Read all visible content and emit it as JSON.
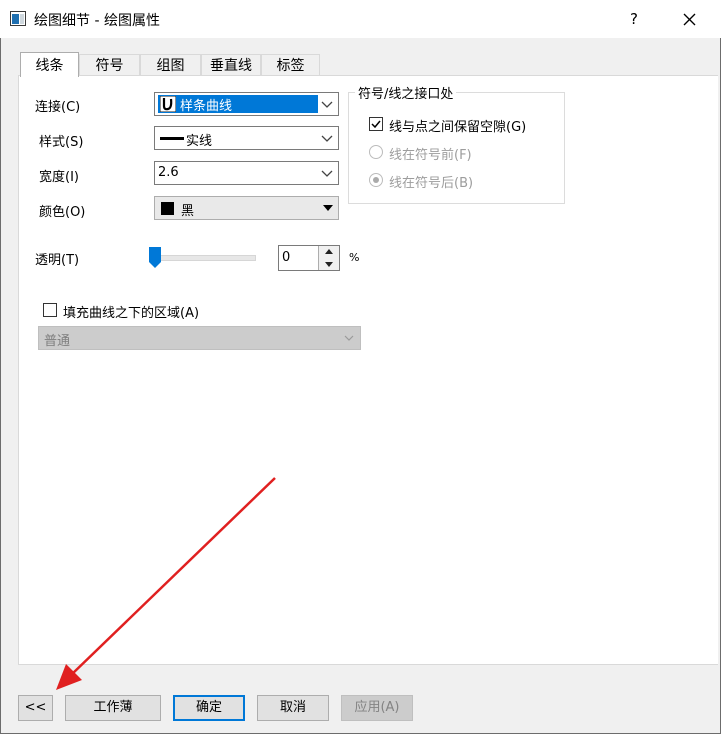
{
  "window": {
    "title": "绘图细节 - 绘图属性",
    "help_label": "?"
  },
  "tabs": [
    {
      "label": "线条",
      "active": true
    },
    {
      "label": "符号",
      "active": false
    },
    {
      "label": "组图",
      "active": false
    },
    {
      "label": "垂直线",
      "active": false
    },
    {
      "label": "标签",
      "active": false
    }
  ],
  "line": {
    "connect": {
      "label": "连接(C)",
      "value": "样条曲线"
    },
    "style": {
      "label": "样式(S)",
      "value": "实线"
    },
    "width": {
      "label": "宽度(I)",
      "value": "2.6"
    },
    "color": {
      "label": "颜色(O)",
      "value": "黑",
      "swatch": "#000000"
    },
    "transparency": {
      "label": "透明(T)",
      "value": "0",
      "unit": "%",
      "slider_fraction": 0.0
    }
  },
  "gap_group": {
    "title": "符号/线之接口处",
    "gap_checkbox": {
      "label": "线与点之间保留空隙(G)",
      "checked": true
    },
    "before_radio": {
      "label": "线在符号前(F)",
      "selected": false
    },
    "after_radio": {
      "label": "线在符号后(B)",
      "selected": true
    }
  },
  "fill": {
    "checkbox_label": "填充曲线之下的区域(A)",
    "checked": false,
    "mode_value": "普通"
  },
  "buttons": {
    "collapse": "<<",
    "workbook": "工作薄",
    "ok": "确定",
    "cancel": "取消",
    "apply": "应用(A)"
  },
  "colors": {
    "accent": "#0078d7",
    "annotation_arrow": "#e02020"
  }
}
